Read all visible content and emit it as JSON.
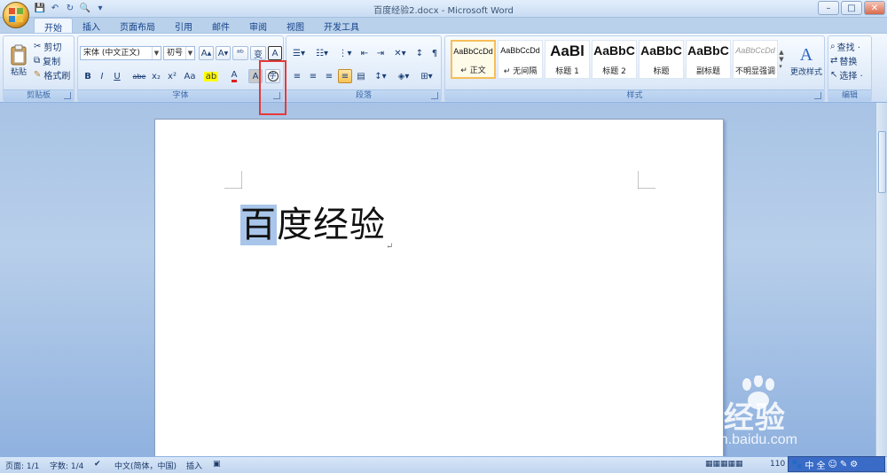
{
  "window": {
    "title": "百度经验2.docx - Microsoft Word",
    "controls": [
      "–",
      "□",
      "✕"
    ]
  },
  "tabs": [
    {
      "label": "开始",
      "active": true
    },
    {
      "label": "插入"
    },
    {
      "label": "页面布局"
    },
    {
      "label": "引用"
    },
    {
      "label": "邮件"
    },
    {
      "label": "审阅"
    },
    {
      "label": "视图"
    },
    {
      "label": "开发工具"
    }
  ],
  "clipboard": {
    "group_label": "剪贴板",
    "paste": "粘贴",
    "cut": "剪切",
    "copy": "复制",
    "format_painter": "格式刷"
  },
  "font": {
    "group_label": "字体",
    "font_name": "宋体 (中文正文)",
    "font_size": "初号",
    "buttons": [
      "B",
      "I",
      "U",
      "abe",
      "x₂",
      "x²",
      "Aa",
      "A",
      "A"
    ]
  },
  "paragraph": {
    "group_label": "段落"
  },
  "styles": {
    "group_label": "样式",
    "items": [
      {
        "sample": "AaBbCcDd",
        "name": "↵ 正文",
        "selected": true
      },
      {
        "sample": "AaBbCcDd",
        "name": "↵ 无间隔"
      },
      {
        "sample": "AaBl",
        "name": "标题 1"
      },
      {
        "sample": "AaBbC",
        "name": "标题 2"
      },
      {
        "sample": "AaBbC",
        "name": "标题"
      },
      {
        "sample": "AaBbC",
        "name": "副标题"
      },
      {
        "sample": "AaBbCcDd",
        "name": "不明显强调"
      }
    ],
    "change_styles": "更改样式"
  },
  "editing": {
    "group_label": "编辑",
    "find": "查找 ·",
    "replace": "替换",
    "select": "选择 ·"
  },
  "document": {
    "selected_text": "百",
    "rest_text": "度经验",
    "paragraph_mark": "↵"
  },
  "statusbar": {
    "page": "页面: 1/1",
    "words": "字数: 1/4",
    "language": "中文(简体，中国)",
    "mode": "插入",
    "zoom": "110"
  },
  "ime": {
    "items": [
      "中",
      "全",
      "☺",
      "✎",
      "⚙"
    ]
  },
  "watermark": {
    "logo_text": "Bai经验",
    "url": "jingyan.baidu.com"
  }
}
